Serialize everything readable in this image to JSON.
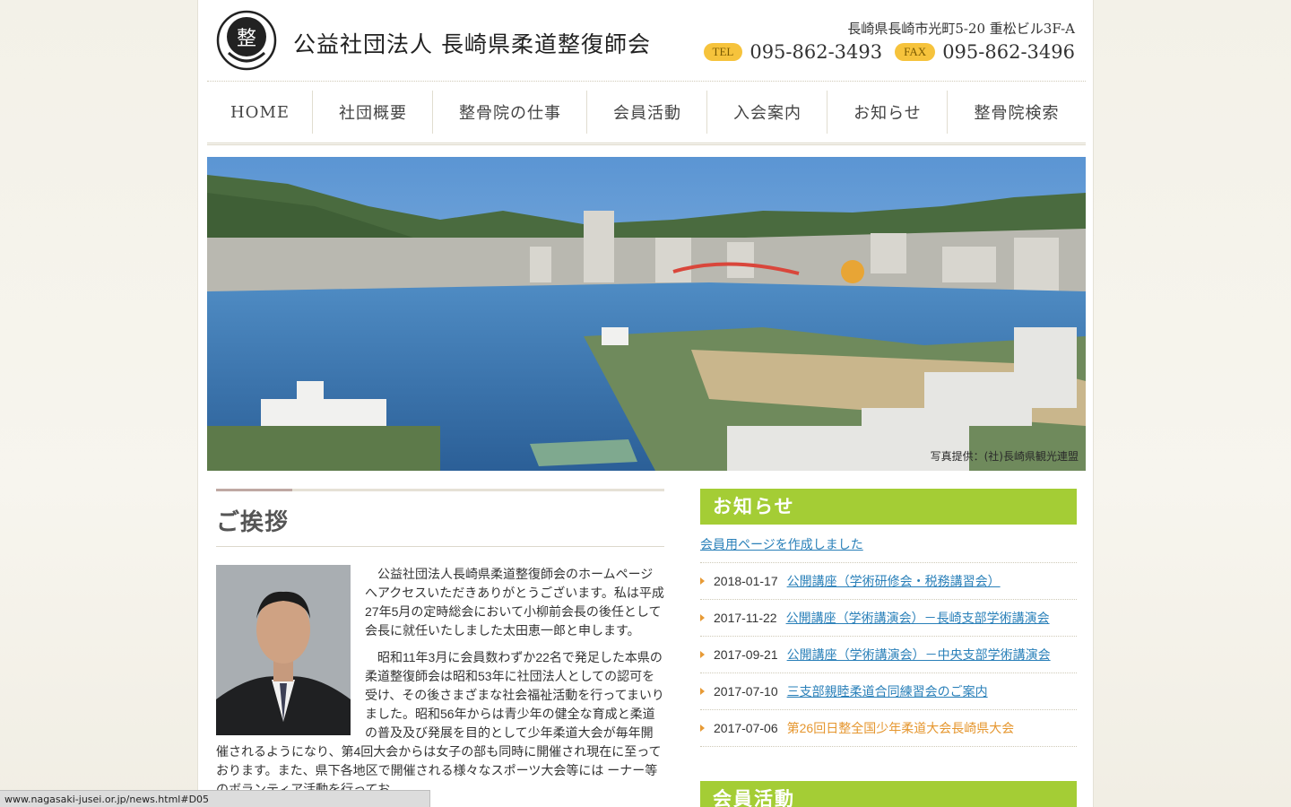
{
  "header": {
    "logo_glyph": "整",
    "title": "公益社団法人 長崎県柔道整復師会",
    "address": "長崎県長崎市光町5-20 重松ビル3F-A",
    "tel_label": "TEL",
    "tel": "095-862-3493",
    "fax_label": "FAX",
    "fax": "095-862-3496"
  },
  "nav": {
    "items": [
      {
        "label": "HOME"
      },
      {
        "label": "社団概要"
      },
      {
        "label": "整骨院の仕事"
      },
      {
        "label": "会員活動"
      },
      {
        "label": "入会案内"
      },
      {
        "label": "お知らせ"
      },
      {
        "label": "整骨院検索"
      }
    ]
  },
  "hero": {
    "credit": "写真提供：(社)長崎県観光連盟"
  },
  "greeting": {
    "title": "ご挨拶",
    "paragraph1": "公益社団法人長崎県柔道整復師会のホームページへアクセスいただきありがとうございます。私は平成27年5月の定時総会において小柳前会長の後任として会長に就任いたしました太田恵一郎と申します。",
    "paragraph2": "昭和11年3月に会員数わずか22名で発足した本県の柔道整復師会は昭和53年に社団法人としての認可を受け、その後さまざまな社会福祉活動を行ってまいりました。昭和56年からは青少年の健全な育成と柔道の普及及び発展を目的として少年柔道大会が毎年開催されるようになり、第4回大会からは女子の部も同時に開催され現在に至っております。また、県下各地区で開催される様々なスポーツ大会等には ーナー等のボランティア活動を行ってお"
  },
  "news": {
    "title": "お知らせ",
    "top_link": "会員用ページを作成しました",
    "items": [
      {
        "date": "2018-01-17",
        "title": "公開講座（学術研修会・税務講習会）"
      },
      {
        "date": "2017-11-22",
        "title": "公開講座（学術講演会）－長崎支部学術講演会"
      },
      {
        "date": "2017-09-21",
        "title": "公開講座（学術講演会）－中央支部学術講演会"
      },
      {
        "date": "2017-07-10",
        "title": "三支部親睦柔道合同練習会のご案内"
      },
      {
        "date": "2017-07-06",
        "title": "第26回日整全国少年柔道大会長崎県大会"
      }
    ]
  },
  "member": {
    "title": "会員活動"
  },
  "statusbar": {
    "url": "www.nagasaki-jusei.or.jp/news.html#D05"
  },
  "colors": {
    "accent_green": "#a4cd35",
    "link_blue": "#2a80b9",
    "highlight_orange": "#e5962e",
    "pill_yellow": "#f6c33c"
  }
}
